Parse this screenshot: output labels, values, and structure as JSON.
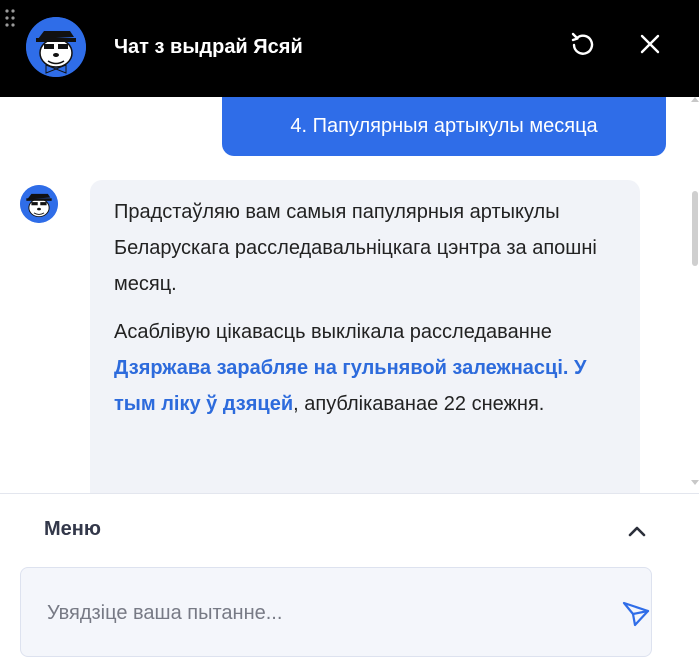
{
  "header": {
    "title": "Чат з выдрай Ясяй"
  },
  "chat": {
    "user_message": "4. Папулярныя артыкулы месяца",
    "bot_message": {
      "p1": "Прадстаўляю вам самыя папулярныя артыкулы Беларускага расследавальніцкага цэнтра за апошні месяц.",
      "p2_before": "Асаблівую цікавасць выклікала расследаванне ",
      "p2_link": "Дзяржава зарабляе на гульнявой залежнасці. У тым ліку ў дзяцей",
      "p2_after": ", апублікаванае 22 снежня."
    }
  },
  "footer": {
    "menu_label": "Меню",
    "input_placeholder": "Увядзіце ваша пытанне..."
  },
  "colors": {
    "header_bg": "#000000",
    "accent": "#2f6de8",
    "link": "#2d6bdc",
    "bubble_bg": "#f1f3f8"
  },
  "icons": {
    "drag": "drag-handle-icon",
    "refresh": "refresh-icon",
    "close": "close-icon",
    "menu_toggle": "chevron-up-icon",
    "send": "send-icon"
  }
}
